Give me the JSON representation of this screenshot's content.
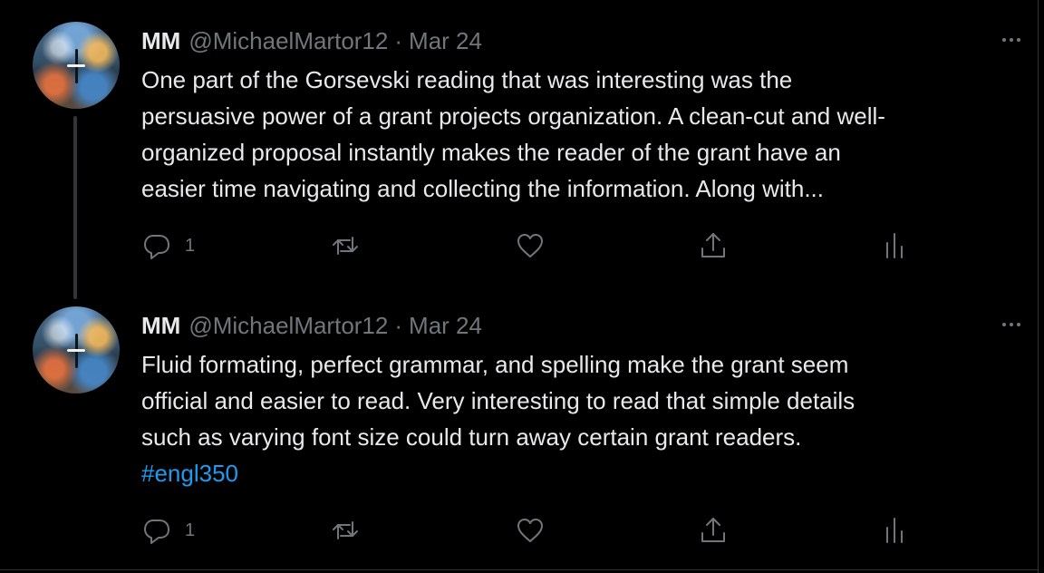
{
  "tweets": [
    {
      "display_name": "MM",
      "handle": "@MichaelMartor12",
      "separator": "·",
      "date": "Mar 24",
      "text_lines": [
        "One part of the Gorsevski reading that was interesting was the",
        "persuasive power of a grant projects organization. A clean-cut and well-",
        "organized proposal instantly makes the reader of the grant have an",
        "easier time navigating and collecting the information. Along with..."
      ],
      "hashtag": "",
      "reply_count": "1"
    },
    {
      "display_name": "MM",
      "handle": "@MichaelMartor12",
      "separator": "·",
      "date": "Mar 24",
      "text_lines": [
        "Fluid formating, perfect grammar, and spelling make the grant seem",
        "official and easier to read. Very interesting to read that simple details",
        "such as varying font size could turn away certain grant readers."
      ],
      "hashtag": "#engl350",
      "reply_count": "1"
    }
  ],
  "icons": {
    "more": "more-horizontal-icon",
    "reply": "reply-icon",
    "retweet": "retweet-icon",
    "like": "heart-icon",
    "share": "share-icon",
    "analytics": "analytics-icon"
  },
  "colors": {
    "background": "#000000",
    "text": "#e7e9ea",
    "secondary": "#71767b",
    "accent": "#1d9bf0",
    "thread_line": "#333639"
  }
}
